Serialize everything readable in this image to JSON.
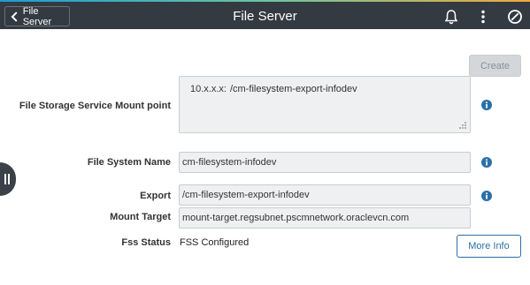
{
  "header": {
    "back_label": "File Server",
    "title": "File Server",
    "icons": [
      "chevron-left-icon",
      "bell-icon",
      "more-vertical-icon",
      "slash-circle-icon"
    ]
  },
  "toolbar": {
    "create_label": "Create"
  },
  "form": {
    "mount_point": {
      "label": "File Storage Service Mount point",
      "ip": "10.x.x.x:",
      "path": "/cm-filesystem-export-infodev"
    },
    "file_system_name": {
      "label": "File System Name",
      "value": "cm-filesystem-infodev"
    },
    "export": {
      "label": "Export",
      "value": "/cm-filesystem-export-infodev"
    },
    "mount_target": {
      "label": "Mount Target",
      "value": "mount-target.regsubnet.pscmnetwork.oraclevcn.com"
    },
    "fss_status": {
      "label": "Fss Status",
      "value": "FSS Configured"
    }
  },
  "actions": {
    "more_info_label": "More Info"
  },
  "colors": {
    "header_bg": "#333a42",
    "accent": "#2a70a8",
    "field_bg": "#eef0f2"
  }
}
